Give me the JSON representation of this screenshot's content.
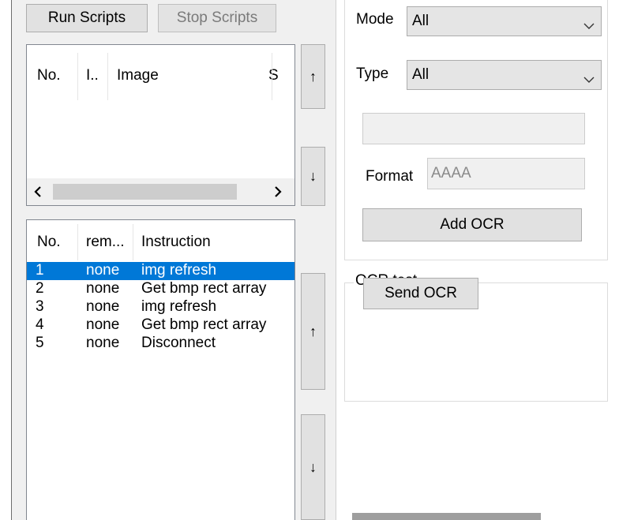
{
  "toolbar": {
    "run_label": "Run Scripts",
    "stop_label": "Stop Scripts"
  },
  "image_list": {
    "columns": [
      "No.",
      "I..",
      "Image",
      "S"
    ],
    "scroll_left_icon": "chevron-left",
    "scroll_right_icon": "chevron-right"
  },
  "image_list_move": {
    "up_glyph": "↑",
    "down_glyph": "↓"
  },
  "script_list": {
    "columns": [
      "No.",
      "rem...",
      "Instruction"
    ],
    "rows": [
      {
        "no": "1",
        "rem": "none",
        "instruction": "img refresh",
        "selected": true
      },
      {
        "no": "2",
        "rem": "none",
        "instruction": "Get bmp rect array",
        "selected": false
      },
      {
        "no": "3",
        "rem": "none",
        "instruction": "img refresh",
        "selected": false
      },
      {
        "no": "4",
        "rem": "none",
        "instruction": "Get bmp rect array",
        "selected": false
      },
      {
        "no": "5",
        "rem": "none",
        "instruction": "Disconnect",
        "selected": false
      }
    ]
  },
  "script_list_move": {
    "up_glyph": "↑",
    "down_glyph": "↓"
  },
  "ocr_settings": {
    "mode_label": "Mode",
    "mode_value": "All",
    "type_label": "Type",
    "type_value": "All",
    "text_value": "",
    "format_label": "Format",
    "format_value": "AAAA",
    "add_button": "Add OCR"
  },
  "ocr_test": {
    "group_title": "OCR test",
    "send_button": "Send OCR"
  },
  "colors": {
    "selection": "#0078d7",
    "button_face": "#e1e1e1",
    "panel": "#ffffff"
  }
}
